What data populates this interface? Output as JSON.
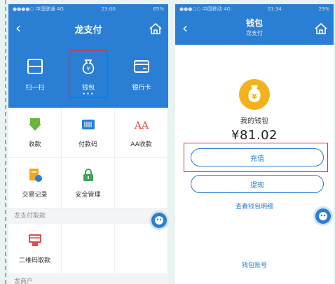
{
  "left": {
    "status": {
      "carrier": "●●●●○ 中国联通 4G",
      "time": "23:00",
      "battery": "65%"
    },
    "title": "龙支付",
    "top_actions": [
      {
        "label": "扫一扫",
        "icon": "scan-icon"
      },
      {
        "label": "钱包",
        "icon": "wallet-bag-icon",
        "dots": "•••"
      },
      {
        "label": "银行卡",
        "icon": "bank-card-icon"
      }
    ],
    "grid_items": [
      {
        "label": "收款",
        "icon": "receive-icon",
        "color": "#6bb53a"
      },
      {
        "label": "付款码",
        "icon": "barcode-icon",
        "color": "#2a7ed3"
      },
      {
        "label": "AA收款",
        "icon": "aa-icon",
        "color": "#e04b4b"
      },
      {
        "label": "交易记录",
        "icon": "record-icon",
        "color": "#f0a81e"
      },
      {
        "label": "安全管理",
        "icon": "lock-icon",
        "color": "#3aa65a"
      },
      {
        "label": "",
        "icon": "",
        "color": ""
      }
    ],
    "section1": "龙支付取款",
    "withdraw_item": {
      "label": "二维码取款",
      "icon": "qr-withdraw-icon",
      "color": "#e04b4b"
    },
    "section2": "龙商户"
  },
  "right": {
    "status": {
      "carrier": "●●●○○ 中国移动 4G",
      "time": "01:34",
      "battery": "29%"
    },
    "title": "钱包",
    "subtitle": "龙支付",
    "wallet_label": "我的钱包",
    "amount": "¥81.02",
    "recharge": "充值",
    "withdraw": "提现",
    "detail_link": "查看钱包明细",
    "account_link": "钱包账号"
  },
  "colors": {
    "brand_blue": "#2a7ed3",
    "highlight_red": "#c73a46",
    "gold": "#f2b21b"
  }
}
